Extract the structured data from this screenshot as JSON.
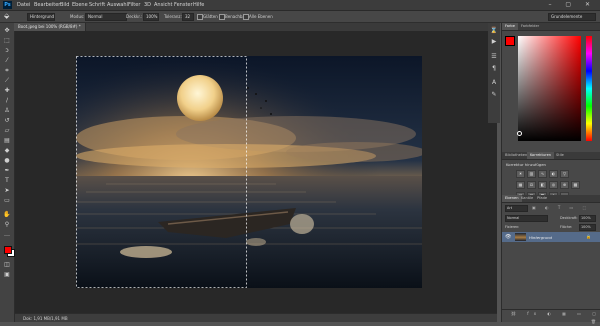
{
  "app": {
    "logo": "Ps"
  },
  "menu": [
    "Datei",
    "Bearbeiten",
    "Bild",
    "Ebene",
    "Schrift",
    "Auswahl",
    "Filter",
    "3D",
    "Ansicht",
    "Fenster",
    "Hilfe"
  ],
  "window_controls": "–  ▢  ✕",
  "options": {
    "sample_select": "Hintergrund",
    "mode_label": "Modus:",
    "mode_value": "Normal",
    "opacity_label": "Deckkr.:",
    "opacity_value": "100%",
    "tolerance_label": "Toleranz:",
    "tolerance_value": "32",
    "smooth_label": "Glätten",
    "contiguous_label": "Benachbart",
    "all_layers_label": "Alle Ebenen",
    "workspace_value": "Grundelemente"
  },
  "document_tab": "Boot.jpeg bei 100% (RGB/8#) *",
  "status_bar": "Dok: 1,91 MB/1,91 MB",
  "panels": {
    "color_tabs": [
      "Farbe",
      "Farbfelder"
    ],
    "adjust_tabs": [
      "Bibliotheken",
      "Korrekturen",
      "Stile"
    ],
    "adjust_title": "Korrektur hinzufügen",
    "layers_tabs": [
      "Ebenen",
      "Kanäle",
      "Pfade"
    ],
    "layers_kind": "Art",
    "layers_blend": "Normal",
    "layers_opacity_label": "Deckkraft:",
    "layers_opacity_value": "100%",
    "layers_lock_label": "Fixieren:",
    "layers_fill_label": "Fläche:",
    "layers_fill_value": "100%",
    "layer_name": "Hintergrund",
    "lock_glyph": "🔒"
  },
  "colors": {
    "foreground": "#ff0000",
    "background": "#ffffff"
  },
  "icons": {
    "tools": [
      "move-icon",
      "marquee-icon",
      "lasso-icon",
      "magic-wand-icon",
      "crop-icon",
      "eyedropper-icon",
      "healing-brush-icon",
      "brush-icon",
      "clone-stamp-icon",
      "history-brush-icon",
      "eraser-icon",
      "gradient-icon",
      "blur-icon",
      "dodge-icon",
      "pen-icon",
      "type-icon",
      "path-select-icon",
      "shape-icon",
      "hand-icon",
      "zoom-icon"
    ],
    "dock": [
      "history-icon",
      "actions-icon",
      "properties-icon",
      "paragraph-icon",
      "character-icon",
      "brush-settings-icon"
    ]
  }
}
